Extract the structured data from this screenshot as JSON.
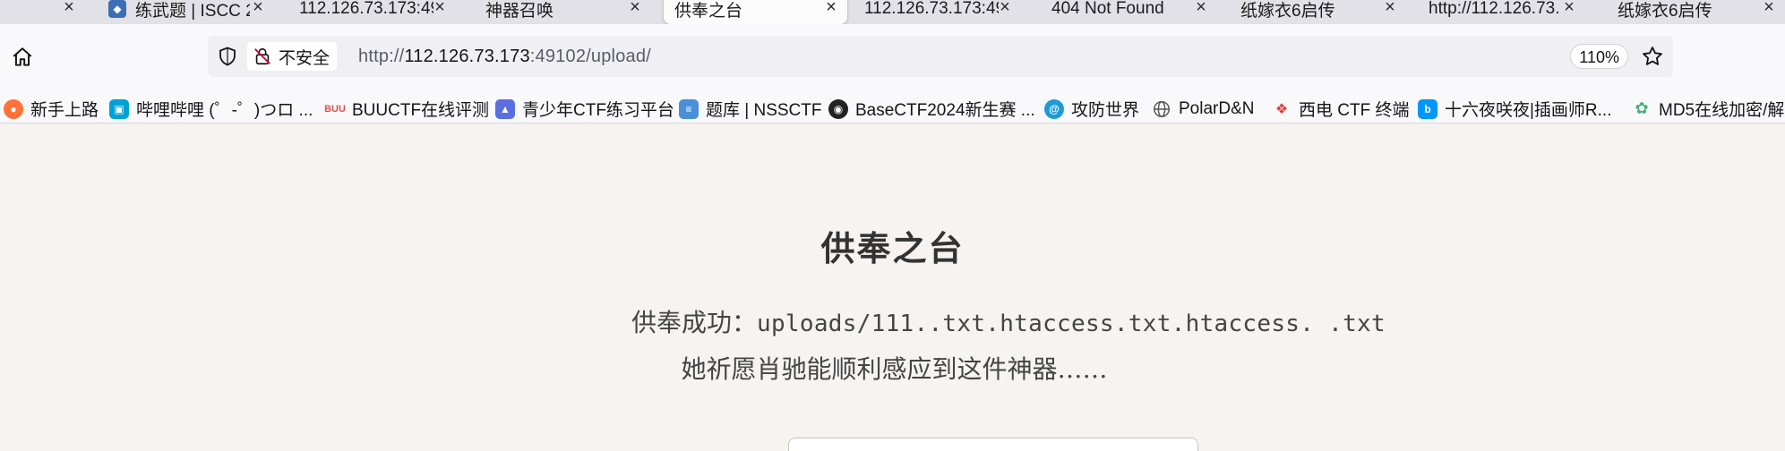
{
  "tabs": [
    {
      "title": "",
      "active": false
    },
    {
      "title": "练武题 | ISCC 2",
      "active": false
    },
    {
      "title": "112.126.73.173:49",
      "active": false
    },
    {
      "title": "神器召唤",
      "active": false
    },
    {
      "title": "供奉之台",
      "active": true
    },
    {
      "title": "112.126.73.173:49",
      "active": false
    },
    {
      "title": "404 Not Found",
      "active": false
    },
    {
      "title": "纸嫁衣6启传",
      "active": false
    },
    {
      "title": "http://112.126.73.",
      "active": false
    },
    {
      "title": "纸嫁衣6启传",
      "active": false
    }
  ],
  "tab_close_glyph": "×",
  "navbar": {
    "insecure_label": "不安全",
    "url_prefix": "http://",
    "url_host": "112.126.73.173",
    "url_rest": ":49102/upload/",
    "zoom": "110%"
  },
  "bookmarks": [
    {
      "label": "新手上路",
      "icon": "firefox-icon",
      "color": "#ff7139"
    },
    {
      "label": "哔哩哔哩 (゜-゜)つロ ...",
      "icon": "bilibili-icon",
      "color": "#00a1d6"
    },
    {
      "label": "BUUCTF在线评测",
      "icon": "buuctf-icon",
      "color": "#d9534f"
    },
    {
      "label": "青少年CTF练习平台",
      "icon": "qsnctf-icon",
      "color": "#5b6ee1"
    },
    {
      "label": "题库 | NSSCTF",
      "icon": "nssctf-icon",
      "color": "#4a90d9"
    },
    {
      "label": "BaseCTF2024新生赛 ...",
      "icon": "basectf-icon",
      "color": "#222222"
    },
    {
      "label": "攻防世界",
      "icon": "adworld-icon",
      "color": "#1e9bd7"
    },
    {
      "label": "PolarD&N",
      "icon": "globe-icon",
      "color": "#555555"
    },
    {
      "label": "西电 CTF 终端",
      "icon": "xidian-icon",
      "color": "#e23b3b"
    },
    {
      "label": "十六夜咲夜|插画师R...",
      "icon": "pixiv-icon",
      "color": "#0096fa"
    },
    {
      "label": "MD5在线加密/解",
      "icon": "md5-icon",
      "color": "#4caf7d"
    }
  ],
  "page": {
    "title": "供奉之台",
    "result_label": "供奉成功：",
    "result_path": "uploads/111..txt.htaccess.txt.htaccess. .txt",
    "flavor_text": "她祈愿肖驰能顺利感应到这件神器……"
  }
}
